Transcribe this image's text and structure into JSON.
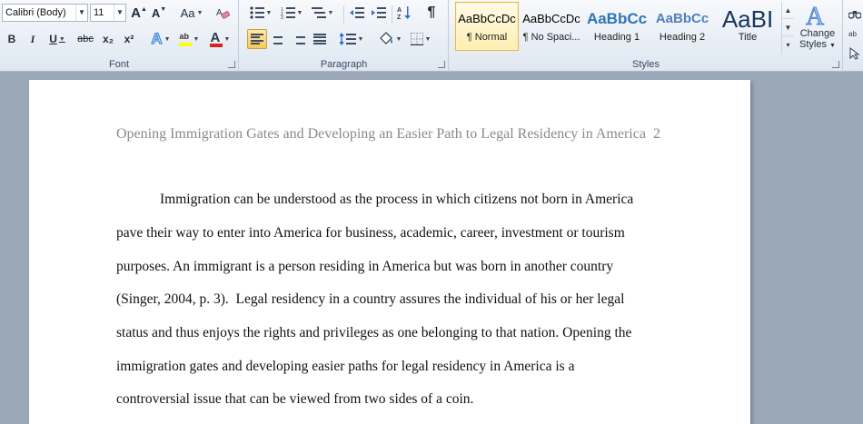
{
  "ribbon": {
    "font": {
      "label": "Font",
      "font_name": "Calibri (Body)",
      "font_size": "11",
      "grow": "A",
      "shrink": "A",
      "change_case": "Aa",
      "bold": "B",
      "italic": "I",
      "underline": "U",
      "strikethrough": "abc",
      "subscript": "x₂",
      "superscript": "x²",
      "font_color_letter": "A"
    },
    "paragraph": {
      "label": "Paragraph",
      "pilcrow": "¶"
    },
    "styles": {
      "label": "Styles",
      "items": [
        {
          "sample": "AaBbCcDc",
          "name": "¶ Normal"
        },
        {
          "sample": "AaBbCcDc",
          "name": "¶ No Spaci..."
        },
        {
          "sample": "AaBbCc",
          "name": "Heading 1"
        },
        {
          "sample": "AaBbCc",
          "name": "Heading 2"
        },
        {
          "sample": "AaBI",
          "name": "Title"
        }
      ],
      "change_styles_line1": "Change",
      "change_styles_line2": "Styles"
    },
    "colors": {
      "accent": "#f7c95a",
      "heading": "#2e74b5",
      "heading2": "#4f81bd"
    }
  },
  "document": {
    "header": "Opening Immigration Gates and Developing an Easier Path to Legal Residency in America",
    "page_number": "2",
    "lines": [
      "Immigration can be understood as the process in which citizens not born in America",
      "pave their way to enter into America for business, academic, career, investment or tourism",
      "purposes. An immigrant is a person residing in America but was born in another country",
      "(Singer, 2004, p. 3).  Legal residency in a country assures the individual of his or her legal",
      "status and thus enjoys the rights and privileges as one belonging to that nation. Opening the",
      "immigration gates and developing easier paths for legal residency in America is a",
      "controversial issue that can be viewed from two sides of a coin."
    ]
  }
}
